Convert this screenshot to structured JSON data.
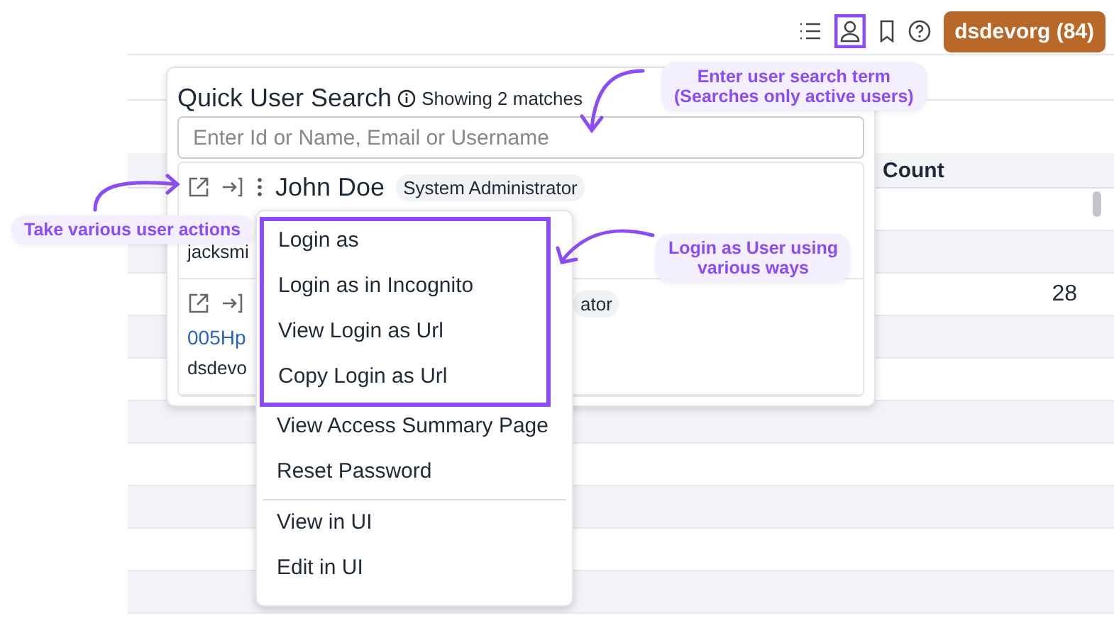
{
  "org_button": "dsdevorg (84)",
  "table": {
    "header": "Count",
    "rows": [
      {
        "value": ""
      },
      {
        "value": ""
      },
      {
        "value": "28"
      },
      {
        "value": ""
      },
      {
        "value": ""
      },
      {
        "value": ""
      },
      {
        "value": ""
      },
      {
        "value": ""
      },
      {
        "value": ""
      },
      {
        "value": ""
      }
    ]
  },
  "quick_user_search": {
    "title": "Quick User Search",
    "match_count": "Showing 2 matches",
    "search": {
      "placeholder": "Enter Id or Name, Email or Username"
    },
    "results": [
      {
        "name": "John Doe",
        "profile": "System Administrator",
        "username": "jacksmi"
      },
      {
        "profile": "ator",
        "id": "005Hp",
        "username": "dsdevo"
      }
    ]
  },
  "action_menu": {
    "groups": [
      {
        "items": [
          {
            "label": "Login as",
            "highlighted": true
          },
          {
            "label": "Login as in Incognito",
            "highlighted": true
          },
          {
            "label": "View Login as Url",
            "highlighted": true
          },
          {
            "label": "Copy Login as Url",
            "highlighted": true
          },
          {
            "label": "View Access Summary Page",
            "highlighted": false
          },
          {
            "label": "Reset Password",
            "highlighted": false
          }
        ]
      },
      {
        "items": [
          {
            "label": "View in UI",
            "highlighted": false
          },
          {
            "label": "Edit in UI",
            "highlighted": false
          }
        ]
      }
    ]
  },
  "annotations": [
    {
      "kind": "search",
      "lines": [
        "Enter user search term",
        "(Searches only active users)"
      ]
    },
    {
      "kind": "actions",
      "lines": [
        "Take various user actions"
      ]
    },
    {
      "kind": "login",
      "lines": [
        "Login as User using",
        "various ways"
      ]
    }
  ]
}
